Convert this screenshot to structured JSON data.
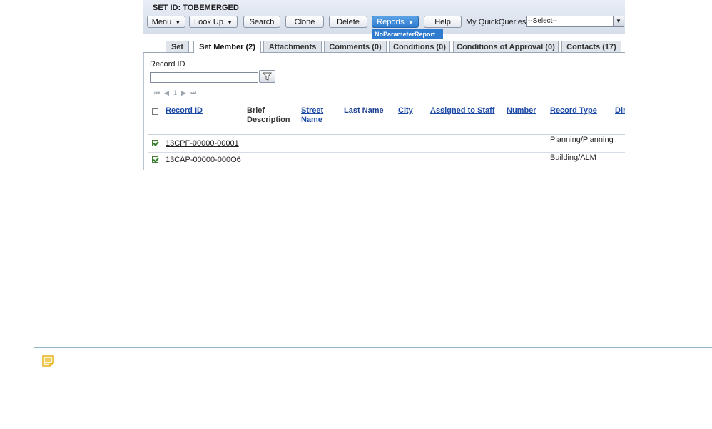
{
  "header": {
    "title": "SET ID: TOBEMERGED",
    "buttons": {
      "menu": "Menu",
      "lookup": "Look Up",
      "search": "Search",
      "clone": "Clone",
      "delete": "Delete",
      "reports": "Reports",
      "help": "Help"
    },
    "reports_dropdown_item": "NoParameterReport",
    "quickqueries_label": "My QuickQueries",
    "quickqueries_value": "--Select--"
  },
  "tabs": [
    {
      "label": "Set"
    },
    {
      "label": "Set Member (2)",
      "active": true
    },
    {
      "label": "Attachments"
    },
    {
      "label": "Comments (0)"
    },
    {
      "label": "Conditions (0)"
    },
    {
      "label": "Conditions of Approval (0)"
    },
    {
      "label": "Contacts (17)"
    }
  ],
  "search": {
    "record_id_label": "Record ID",
    "record_id_value": ""
  },
  "pager": {
    "page": "1"
  },
  "grid": {
    "columns": {
      "record_id": "Record ID",
      "brief_1": "Brief",
      "brief_2": "Description",
      "street_1": "Street",
      "street_2": "Name",
      "last_name": "Last Name",
      "city": "City",
      "assigned": "Assigned to Staff",
      "number": "Number",
      "record_type": "Record Type",
      "dir": "Dir"
    },
    "rows": [
      {
        "record_id": "13CPF-00000-00001",
        "record_type": "Planning/Planning",
        "checked": true
      },
      {
        "record_id": "13CAP-00000-000O6",
        "record_type": "Building/ALM",
        "checked": true
      }
    ]
  },
  "colors": {
    "accent": "#2f7bd0",
    "link": "#1c4aa6",
    "rule": "#8fb3c9",
    "note_icon": "#e8b21c"
  }
}
